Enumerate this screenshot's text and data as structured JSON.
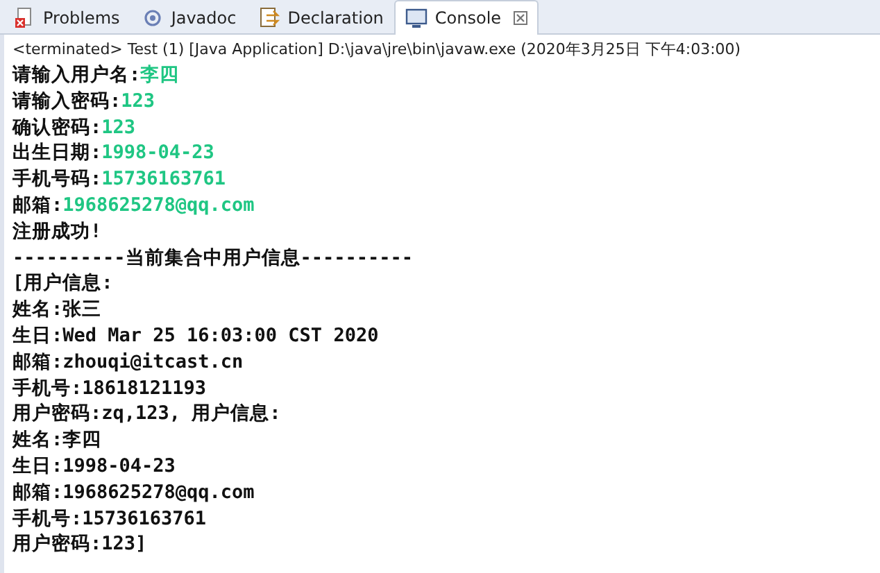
{
  "tabs": [
    {
      "label": "Problems",
      "selected": false
    },
    {
      "label": "Javadoc",
      "selected": false
    },
    {
      "label": "Declaration",
      "selected": false
    },
    {
      "label": "Console",
      "selected": true
    }
  ],
  "status": "<terminated> Test (1) [Java Application] D:\\java\\jre\\bin\\javaw.exe (2020年3月25日 下午4:03:00)",
  "lines": [
    {
      "output": "请输入用户名:",
      "input": "李四"
    },
    {
      "output": "请输入密码:",
      "input": "123"
    },
    {
      "output": "确认密码:",
      "input": "123"
    },
    {
      "output": "出生日期:",
      "input": "1998-04-23"
    },
    {
      "output": "手机号码:",
      "input": "15736163761"
    },
    {
      "output": "邮箱:",
      "input": "1968625278@qq.com"
    },
    {
      "output": "注册成功!"
    },
    {
      "output": "----------当前集合中用户信息----------"
    },
    {
      "output": "[用户信息:"
    },
    {
      "output": "姓名:张三"
    },
    {
      "output": "生日:Wed Mar 25 16:03:00 CST 2020"
    },
    {
      "output": "邮箱:zhouqi@itcast.cn"
    },
    {
      "output": "手机号:18618121193"
    },
    {
      "output": "用户密码:zq,123, 用户信息:"
    },
    {
      "output": "姓名:李四"
    },
    {
      "output": "生日:1998-04-23"
    },
    {
      "output": "邮箱:1968625278@qq.com"
    },
    {
      "output": "手机号:15736163761"
    },
    {
      "output": "用户密码:123]"
    }
  ]
}
